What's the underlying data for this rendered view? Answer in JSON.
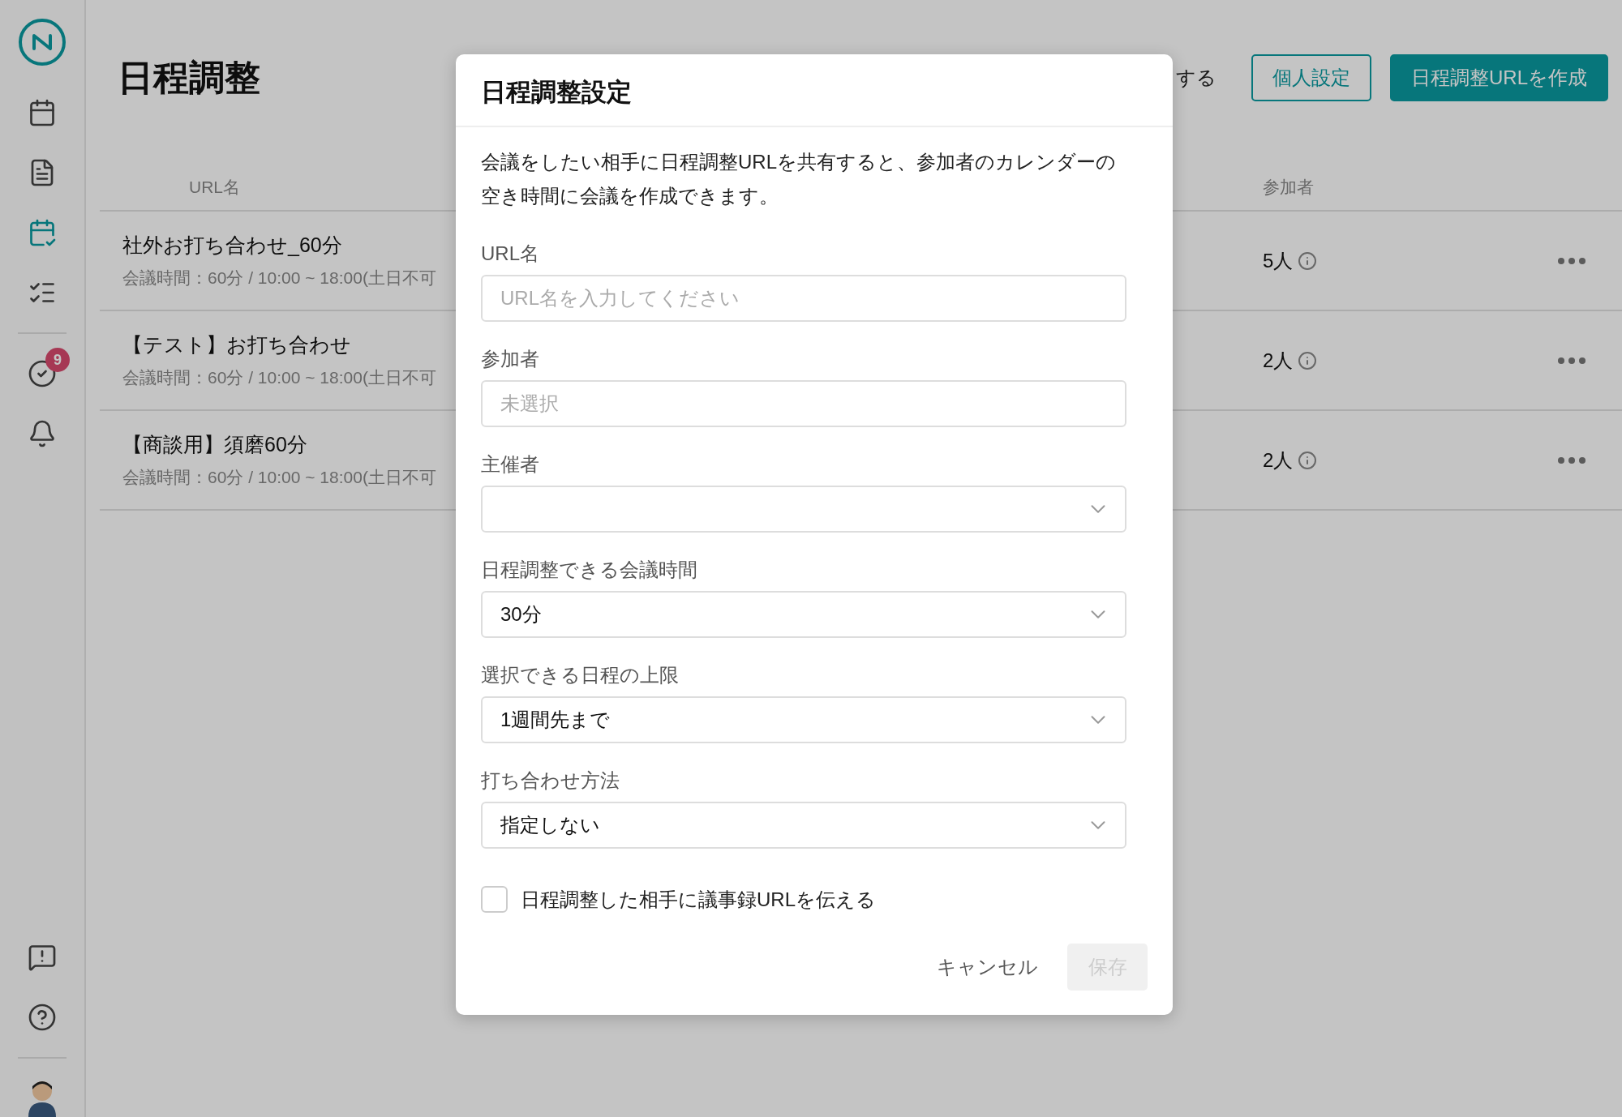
{
  "sidebar": {
    "top_items": [
      {
        "kind": "calendar",
        "selected": false
      },
      {
        "kind": "notes",
        "selected": false
      },
      {
        "kind": "schedule",
        "selected": true
      },
      {
        "kind": "checklist",
        "selected": false
      }
    ],
    "middle_items": [
      {
        "kind": "tasks",
        "selected": false,
        "badge": "9"
      },
      {
        "kind": "bell",
        "selected": false
      }
    ],
    "bottom_items": [
      {
        "kind": "feedback",
        "selected": false
      },
      {
        "kind": "help",
        "selected": false
      }
    ]
  },
  "page": {
    "title": "日程調整",
    "partial_action": "する",
    "buttons": [
      {
        "label": "個人設定",
        "kind": "secondary"
      },
      {
        "label": "日程調整URLを作成",
        "kind": "primary"
      }
    ]
  },
  "table": {
    "columns": [
      "URL名",
      "参加者"
    ],
    "rows": [
      {
        "name": "社外お打ち合わせ_60分",
        "detail": "会議時間：60分 / 10:00 ~ 18:00(土日不可",
        "participants": "5人"
      },
      {
        "name": "【テスト】お打ち合わせ",
        "detail": "会議時間：60分 / 10:00 ~ 18:00(土日不可",
        "participants": "2人"
      },
      {
        "name": "【商談用】須磨60分",
        "detail": "会議時間：60分 / 10:00 ~ 18:00(土日不可",
        "participants": "2人"
      }
    ]
  },
  "dialog": {
    "title": "日程調整設定",
    "description": "会議をしたい相手に日程調整URLを共有すると、参加者のカレンダーの空き時間に会議を作成できます。",
    "fields": [
      {
        "kind": "text",
        "label": "URL名",
        "placeholder": "URL名を入力してください"
      },
      {
        "kind": "text",
        "label": "参加者",
        "placeholder": "未選択"
      },
      {
        "kind": "select",
        "label": "主催者"
      },
      {
        "kind": "select",
        "label": "日程調整できる会議時間",
        "value": "30分"
      },
      {
        "kind": "select",
        "label": "選択できる日程の上限",
        "value": "1週間先まで"
      },
      {
        "kind": "select",
        "label": "打ち合わせ方法",
        "value": "指定しない"
      }
    ],
    "checkbox": {
      "label": "日程調整した相手に議事録URLを伝える",
      "checked": false
    },
    "cancel": "キャンセル",
    "save": {
      "label": "保存",
      "disabled": true
    }
  }
}
